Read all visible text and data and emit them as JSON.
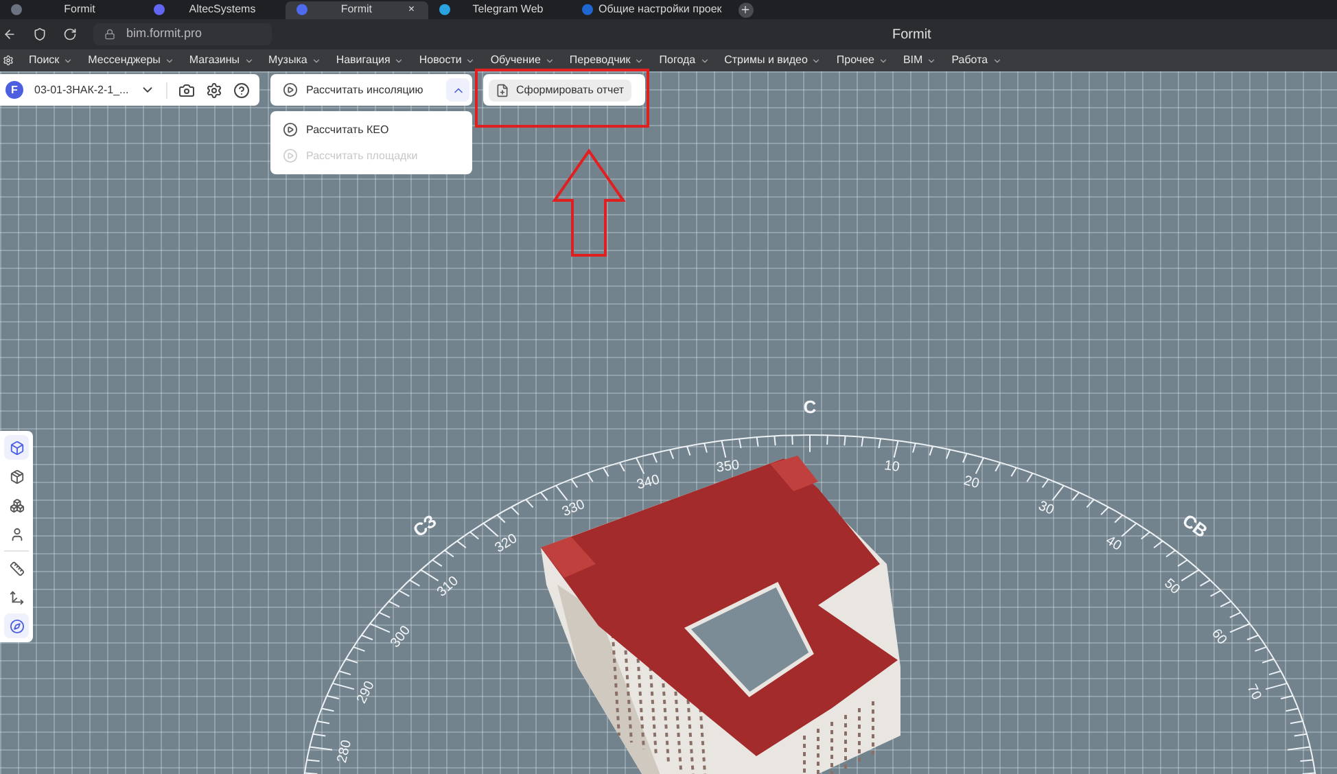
{
  "browser": {
    "tabs": [
      {
        "title": "Formit",
        "selected": false
      },
      {
        "title": "AltecSystems",
        "selected": false
      },
      {
        "title": "Formit",
        "selected": true,
        "close": "×"
      },
      {
        "title": "Telegram Web",
        "selected": false
      },
      {
        "title": "Общие настройки проек",
        "selected": false
      }
    ],
    "url": "bim.formit.pro",
    "page_title": "Formit",
    "bookmarks": [
      "Поиск",
      "Мессенджеры",
      "Магазины",
      "Музыка",
      "Навигация",
      "Новости",
      "Обучение",
      "Переводчик",
      "Погода",
      "Стримы и видео",
      "Прочее",
      "BIM",
      "Работа"
    ]
  },
  "toolbar": {
    "logo": "F",
    "project": "03-01-3НАК-2-1_...",
    "calc_button": "Рассчитать инсоляцию",
    "menu_expanded": true,
    "menu": [
      {
        "label": "Рассчитать КЕО",
        "disabled": false
      },
      {
        "label": "Рассчитать площадки",
        "disabled": true
      }
    ],
    "report_button": "Сформировать отчет"
  },
  "sidebar": {
    "items": [
      {
        "selected": true
      },
      {
        "selected": false
      },
      {
        "selected": false
      },
      {
        "selected": false
      },
      {
        "selected": false
      },
      {
        "selected": false
      },
      {
        "selected": true
      }
    ]
  },
  "compass": {
    "directions": [
      "С",
      "СВ",
      "СЗ"
    ],
    "degrees": [
      "350",
      "340",
      "330",
      "320",
      "310",
      "300",
      "290",
      "280",
      "10",
      "20",
      "30",
      "40",
      "50",
      "60",
      "70"
    ]
  }
}
